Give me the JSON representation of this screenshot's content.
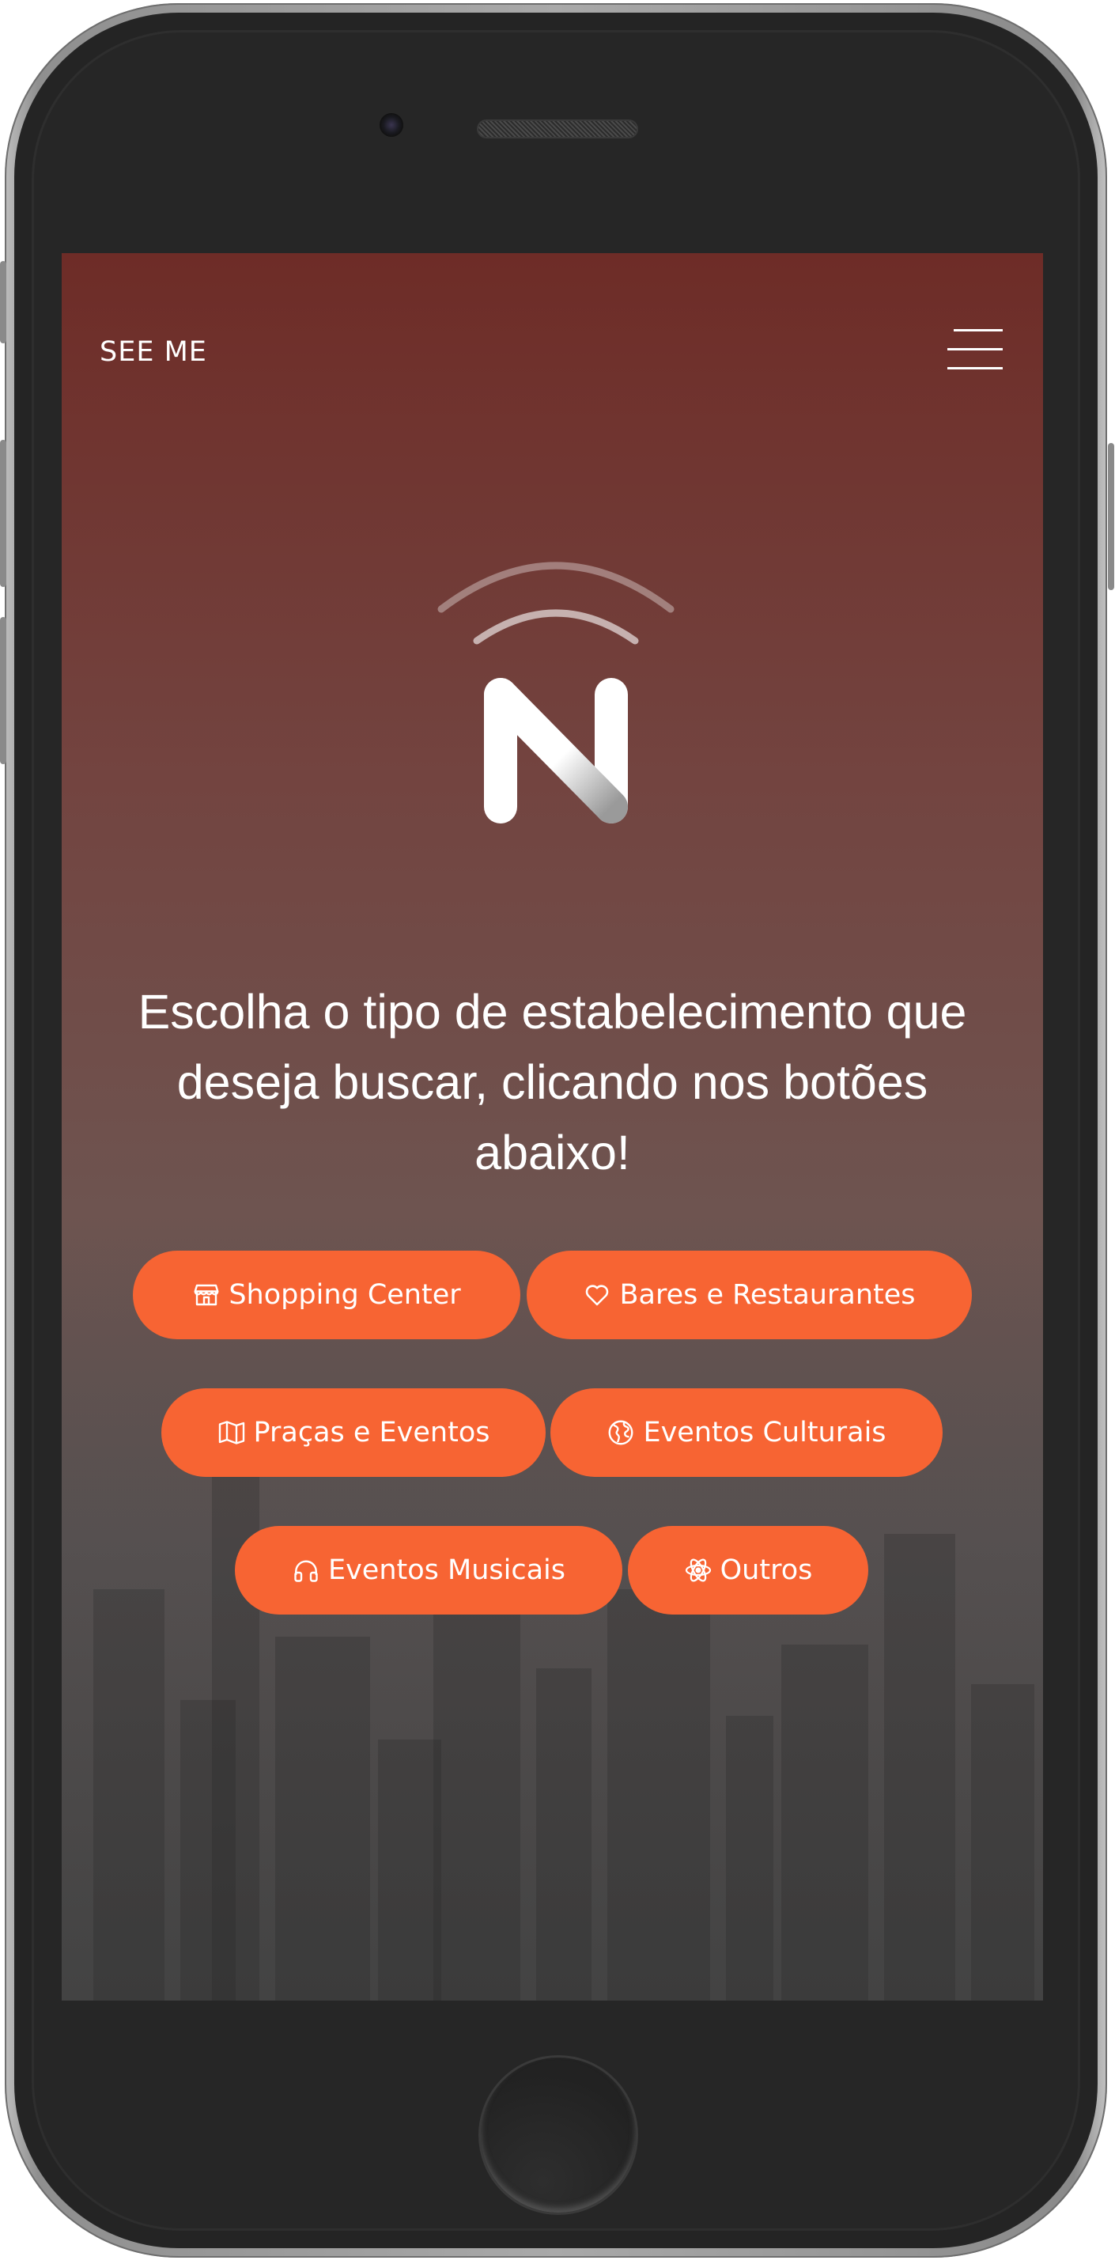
{
  "app": {
    "brand": "SEE ME"
  },
  "hero": {
    "headline": "Escolha o tipo de estabelecimento que deseja buscar, clicando nos botões abaixo!"
  },
  "categories": [
    {
      "label": "Shopping Center",
      "icon": "store-icon"
    },
    {
      "label": "Bares e Restaurantes",
      "icon": "heart-icon"
    },
    {
      "label": "Praças e Eventos",
      "icon": "map-icon"
    },
    {
      "label": "Eventos Culturais",
      "icon": "globe-icon"
    },
    {
      "label": "Eventos Musicais",
      "icon": "headphones-icon"
    },
    {
      "label": "Outros",
      "icon": "atom-icon"
    }
  ],
  "colors": {
    "accent": "#f76433",
    "bg_top": "#6e2c27",
    "bg_bottom": "#4a4a4a"
  }
}
